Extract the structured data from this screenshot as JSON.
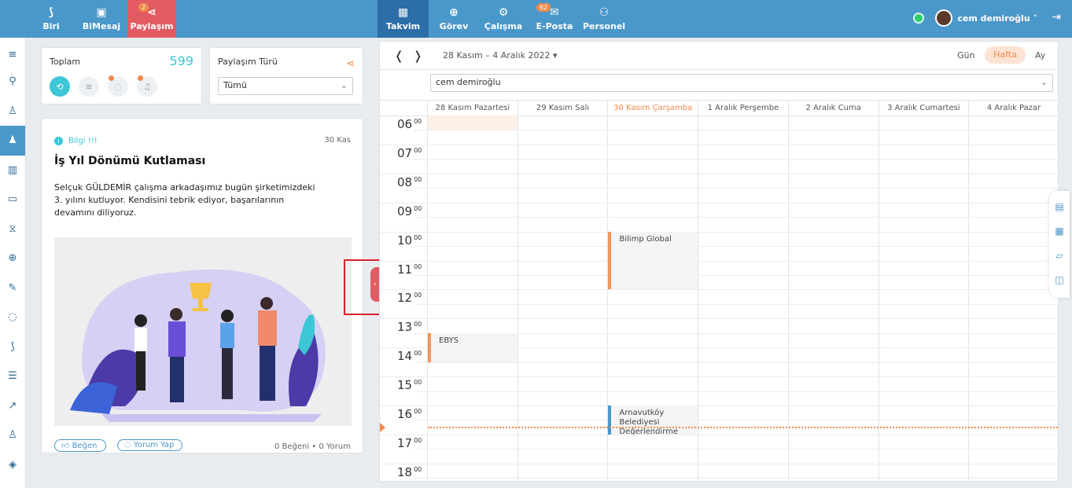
{
  "topnav": {
    "left": [
      {
        "label": "Biri",
        "icon": "rss-icon"
      },
      {
        "label": "BiMesaj",
        "icon": "chat-box-icon"
      },
      {
        "label": "Paylaşım",
        "icon": "share-icon",
        "badge": "2"
      }
    ],
    "center": [
      {
        "label": "Takvim",
        "icon": "calendar-icon"
      },
      {
        "label": "Görev",
        "icon": "target-icon"
      },
      {
        "label": "Çalışma",
        "icon": "gear-icon"
      },
      {
        "label": "E-Posta",
        "icon": "mail-icon",
        "badge": "62"
      },
      {
        "label": "Personel",
        "icon": "people-icon"
      }
    ],
    "user_name": "cem demiroğlu ˅"
  },
  "summary": {
    "total_label": "Toplam",
    "total_value": "599",
    "type_label": "Paylaşım Türü",
    "type_value": "Tümü"
  },
  "post": {
    "tag": "Bilgi !!!",
    "date": "30 Kas",
    "title": "İş Yıl Dönümü Kutlaması",
    "body": "Selçuk GÜLDEMİR çalışma arkadaşımız bugün şirketimizdeki 3. yılını kutluyor. Kendisini tebrik ediyor, başarılarının devamını diliyoruz.",
    "like_label": "Beğen",
    "comment_label": "Yorum Yap",
    "stats": "0 Beğeni • 0 Yorum"
  },
  "calendar": {
    "range": "28 Kasım – 4 Aralık 2022",
    "view_day": "Gün",
    "view_week": "Hafta",
    "view_month": "Ay",
    "person": "cem demiroğlu",
    "days": [
      "28 Kasım Pazartesi",
      "29 Kasım Salı",
      "30 Kasım Çarşamba",
      "1 Aralık Perşembe",
      "2 Aralık Cuma",
      "3 Aralık Cumartesi",
      "4 Aralık Pazar"
    ],
    "hours": [
      "06",
      "07",
      "08",
      "09",
      "10",
      "11",
      "12",
      "13",
      "14",
      "15",
      "16",
      "17",
      "18"
    ],
    "minute": "00",
    "events": [
      {
        "title": "Bilimp Global",
        "day": 2,
        "start": 10,
        "end": 12,
        "color": "#f0955a"
      },
      {
        "title": "EBYS",
        "day": 0,
        "start": 13.5,
        "end": 14.5,
        "color": "#f0955a"
      },
      {
        "title": "Arnavutköy Belediyesi Değerlendirme",
        "day": 2,
        "start": 16,
        "end": 17,
        "color": "#4a97c9"
      }
    ]
  },
  "colors": {
    "accent": "#4a97c9",
    "active_red": "#e35b62",
    "orange": "#f08a4b",
    "teal": "#3cc6d6"
  }
}
